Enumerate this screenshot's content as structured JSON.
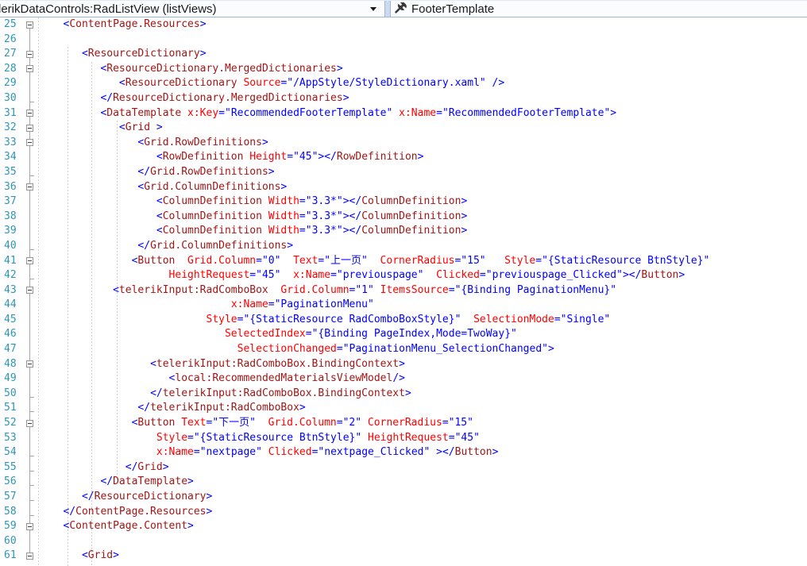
{
  "navbar": {
    "element_dropdown": {
      "label": "lerikDataControls:RadListView (listViews)",
      "caret_icon": "caret-down"
    },
    "member_dropdown": {
      "label": "FooterTemplate",
      "icon": "wrench-icon"
    }
  },
  "colors": {
    "delimiter": "#0000FF",
    "element_name": "#A31515",
    "attribute_name": "#FF0000",
    "attribute_value": "#0000FF",
    "line_number": "#2E95B5",
    "navbar_border": "#9CB6D4"
  },
  "editor": {
    "first_line": 25,
    "last_line": 61,
    "lines": [
      {
        "num": 25,
        "fold": true,
        "indent": 3,
        "segments": [
          [
            "d",
            "<"
          ],
          [
            "e",
            "ContentPage.Resources"
          ],
          [
            "d",
            ">"
          ]
        ]
      },
      {
        "num": 26,
        "indent": 0,
        "segments": []
      },
      {
        "num": 27,
        "fold": true,
        "indent": 6,
        "segments": [
          [
            "d",
            "<"
          ],
          [
            "e",
            "ResourceDictionary"
          ],
          [
            "d",
            ">"
          ]
        ]
      },
      {
        "num": 28,
        "fold": true,
        "indent": 9,
        "segments": [
          [
            "d",
            "<"
          ],
          [
            "e",
            "ResourceDictionary.MergedDictionaries"
          ],
          [
            "d",
            ">"
          ]
        ]
      },
      {
        "num": 29,
        "indent": 12,
        "segments": [
          [
            "d",
            "<"
          ],
          [
            "e",
            "ResourceDictionary"
          ],
          [
            "s",
            " "
          ],
          [
            "a",
            "Source"
          ],
          [
            "d",
            "="
          ],
          [
            "v",
            "\"/AppStyle/StyleDictionary.xaml\""
          ],
          [
            "s",
            " "
          ],
          [
            "d",
            "/>"
          ]
        ]
      },
      {
        "num": 30,
        "tick": true,
        "indent": 9,
        "segments": [
          [
            "d",
            "</"
          ],
          [
            "e",
            "ResourceDictionary.MergedDictionaries"
          ],
          [
            "d",
            ">"
          ]
        ]
      },
      {
        "num": 31,
        "fold": true,
        "indent": 9,
        "segments": [
          [
            "d",
            "<"
          ],
          [
            "e",
            "DataTemplate"
          ],
          [
            "s",
            " "
          ],
          [
            "a",
            "x:Key"
          ],
          [
            "d",
            "="
          ],
          [
            "v",
            "\"RecommendedFooterTemplate\""
          ],
          [
            "s",
            " "
          ],
          [
            "a",
            "x:Name"
          ],
          [
            "d",
            "="
          ],
          [
            "v",
            "\"RecommendedFooterTemplate\""
          ],
          [
            "d",
            ">"
          ]
        ]
      },
      {
        "num": 32,
        "fold": true,
        "indent": 12,
        "segments": [
          [
            "d",
            "<"
          ],
          [
            "e",
            "Grid"
          ],
          [
            "s",
            " "
          ],
          [
            "d",
            ">"
          ]
        ]
      },
      {
        "num": 33,
        "fold": true,
        "indent": 15,
        "segments": [
          [
            "d",
            "<"
          ],
          [
            "e",
            "Grid.RowDefinitions"
          ],
          [
            "d",
            ">"
          ]
        ]
      },
      {
        "num": 34,
        "indent": 18,
        "segments": [
          [
            "d",
            "<"
          ],
          [
            "e",
            "RowDefinition"
          ],
          [
            "s",
            " "
          ],
          [
            "a",
            "Height"
          ],
          [
            "d",
            "="
          ],
          [
            "v",
            "\"45\""
          ],
          [
            "d",
            "></"
          ],
          [
            "e",
            "RowDefinition"
          ],
          [
            "d",
            ">"
          ]
        ]
      },
      {
        "num": 35,
        "tick": true,
        "indent": 15,
        "segments": [
          [
            "d",
            "</"
          ],
          [
            "e",
            "Grid.RowDefinitions"
          ],
          [
            "d",
            ">"
          ]
        ]
      },
      {
        "num": 36,
        "fold": true,
        "indent": 15,
        "segments": [
          [
            "d",
            "<"
          ],
          [
            "e",
            "Grid.ColumnDefinitions"
          ],
          [
            "d",
            ">"
          ]
        ]
      },
      {
        "num": 37,
        "indent": 18,
        "segments": [
          [
            "d",
            "<"
          ],
          [
            "e",
            "ColumnDefinition"
          ],
          [
            "s",
            " "
          ],
          [
            "a",
            "Width"
          ],
          [
            "d",
            "="
          ],
          [
            "v",
            "\"3.3*\""
          ],
          [
            "d",
            "></"
          ],
          [
            "e",
            "ColumnDefinition"
          ],
          [
            "d",
            ">"
          ]
        ]
      },
      {
        "num": 38,
        "indent": 18,
        "segments": [
          [
            "d",
            "<"
          ],
          [
            "e",
            "ColumnDefinition"
          ],
          [
            "s",
            " "
          ],
          [
            "a",
            "Width"
          ],
          [
            "d",
            "="
          ],
          [
            "v",
            "\"3.3*\""
          ],
          [
            "d",
            "></"
          ],
          [
            "e",
            "ColumnDefinition"
          ],
          [
            "d",
            ">"
          ]
        ]
      },
      {
        "num": 39,
        "indent": 18,
        "segments": [
          [
            "d",
            "<"
          ],
          [
            "e",
            "ColumnDefinition"
          ],
          [
            "s",
            " "
          ],
          [
            "a",
            "Width"
          ],
          [
            "d",
            "="
          ],
          [
            "v",
            "\"3.3*\""
          ],
          [
            "d",
            "></"
          ],
          [
            "e",
            "ColumnDefinition"
          ],
          [
            "d",
            ">"
          ]
        ]
      },
      {
        "num": 40,
        "tick": true,
        "indent": 15,
        "segments": [
          [
            "d",
            "</"
          ],
          [
            "e",
            "Grid.ColumnDefinitions"
          ],
          [
            "d",
            ">"
          ]
        ]
      },
      {
        "num": 41,
        "fold": true,
        "indent": 14,
        "segments": [
          [
            "d",
            "<"
          ],
          [
            "e",
            "Button"
          ],
          [
            "s",
            "  "
          ],
          [
            "a",
            "Grid.Column"
          ],
          [
            "d",
            "="
          ],
          [
            "v",
            "\"0\""
          ],
          [
            "s",
            "  "
          ],
          [
            "a",
            "Text"
          ],
          [
            "d",
            "="
          ],
          [
            "v",
            "\"上一页\""
          ],
          [
            "s",
            "  "
          ],
          [
            "a",
            "CornerRadius"
          ],
          [
            "d",
            "="
          ],
          [
            "v",
            "\"15\""
          ],
          [
            "s",
            "   "
          ],
          [
            "a",
            "Style"
          ],
          [
            "d",
            "="
          ],
          [
            "v",
            "\"{StaticResource BtnStyle}\""
          ]
        ]
      },
      {
        "num": 42,
        "tick": true,
        "indent": 20,
        "segments": [
          [
            "a",
            "HeightRequest"
          ],
          [
            "d",
            "="
          ],
          [
            "v",
            "\"45\""
          ],
          [
            "s",
            "  "
          ],
          [
            "a",
            "x:Name"
          ],
          [
            "d",
            "="
          ],
          [
            "v",
            "\"previouspage\""
          ],
          [
            "s",
            "  "
          ],
          [
            "a",
            "Clicked"
          ],
          [
            "d",
            "="
          ],
          [
            "v",
            "\"previouspage_Clicked\""
          ],
          [
            "d",
            "></"
          ],
          [
            "e",
            "Button"
          ],
          [
            "d",
            ">"
          ]
        ]
      },
      {
        "num": 43,
        "fold": true,
        "indent": 11,
        "segments": [
          [
            "d",
            "<"
          ],
          [
            "e",
            "telerikInput:RadComboBox"
          ],
          [
            "s",
            "  "
          ],
          [
            "a",
            "Grid.Column"
          ],
          [
            "d",
            "="
          ],
          [
            "v",
            "\"1\""
          ],
          [
            "s",
            " "
          ],
          [
            "a",
            "ItemsSource"
          ],
          [
            "d",
            "="
          ],
          [
            "v",
            "\"{Binding PaginationMenu}\""
          ]
        ]
      },
      {
        "num": 44,
        "indent": 30,
        "segments": [
          [
            "a",
            "x:Name"
          ],
          [
            "d",
            "="
          ],
          [
            "v",
            "\"PaginationMenu\""
          ]
        ]
      },
      {
        "num": 45,
        "indent": 26,
        "segments": [
          [
            "a",
            "Style"
          ],
          [
            "d",
            "="
          ],
          [
            "v",
            "\"{StaticResource RadComboBoxStyle}\""
          ],
          [
            "s",
            "  "
          ],
          [
            "a",
            "SelectionMode"
          ],
          [
            "d",
            "="
          ],
          [
            "v",
            "\"Single\""
          ]
        ]
      },
      {
        "num": 46,
        "indent": 29,
        "segments": [
          [
            "a",
            "SelectedIndex"
          ],
          [
            "d",
            "="
          ],
          [
            "v",
            "\"{Binding PageIndex,Mode=TwoWay}\""
          ]
        ]
      },
      {
        "num": 47,
        "indent": 31,
        "segments": [
          [
            "a",
            "SelectionChanged"
          ],
          [
            "d",
            "="
          ],
          [
            "v",
            "\"PaginationMenu_SelectionChanged\""
          ],
          [
            "d",
            ">"
          ]
        ]
      },
      {
        "num": 48,
        "fold": true,
        "indent": 17,
        "segments": [
          [
            "d",
            "<"
          ],
          [
            "e",
            "telerikInput:RadComboBox.BindingContext"
          ],
          [
            "d",
            ">"
          ]
        ]
      },
      {
        "num": 49,
        "indent": 20,
        "segments": [
          [
            "d",
            "<"
          ],
          [
            "e",
            "local:RecommendedMaterialsViewModel"
          ],
          [
            "d",
            "/>"
          ]
        ]
      },
      {
        "num": 50,
        "tick": true,
        "indent": 17,
        "segments": [
          [
            "d",
            "</"
          ],
          [
            "e",
            "telerikInput:RadComboBox.BindingContext"
          ],
          [
            "d",
            ">"
          ]
        ]
      },
      {
        "num": 51,
        "tick": true,
        "indent": 15,
        "segments": [
          [
            "d",
            "</"
          ],
          [
            "e",
            "telerikInput:RadComboBox"
          ],
          [
            "d",
            ">"
          ]
        ]
      },
      {
        "num": 52,
        "fold": true,
        "indent": 14,
        "segments": [
          [
            "d",
            "<"
          ],
          [
            "e",
            "Button"
          ],
          [
            "s",
            " "
          ],
          [
            "a",
            "Text"
          ],
          [
            "d",
            "="
          ],
          [
            "v",
            "\"下一页\""
          ],
          [
            "s",
            "  "
          ],
          [
            "a",
            "Grid.Column"
          ],
          [
            "d",
            "="
          ],
          [
            "v",
            "\"2\""
          ],
          [
            "s",
            " "
          ],
          [
            "a",
            "CornerRadius"
          ],
          [
            "d",
            "="
          ],
          [
            "v",
            "\"15\""
          ]
        ]
      },
      {
        "num": 53,
        "indent": 18,
        "segments": [
          [
            "a",
            "Style"
          ],
          [
            "d",
            "="
          ],
          [
            "v",
            "\"{StaticResource BtnStyle}\""
          ],
          [
            "s",
            " "
          ],
          [
            "a",
            "HeightRequest"
          ],
          [
            "d",
            "="
          ],
          [
            "v",
            "\"45\""
          ]
        ]
      },
      {
        "num": 54,
        "tick": true,
        "indent": 18,
        "segments": [
          [
            "a",
            "x:Name"
          ],
          [
            "d",
            "="
          ],
          [
            "v",
            "\"nextpage\""
          ],
          [
            "s",
            " "
          ],
          [
            "a",
            "Clicked"
          ],
          [
            "d",
            "="
          ],
          [
            "v",
            "\"nextpage_Clicked\""
          ],
          [
            "s",
            " "
          ],
          [
            "d",
            "></"
          ],
          [
            "e",
            "Button"
          ],
          [
            "d",
            ">"
          ]
        ]
      },
      {
        "num": 55,
        "tick": true,
        "indent": 13,
        "segments": [
          [
            "d",
            "</"
          ],
          [
            "e",
            "Grid"
          ],
          [
            "d",
            ">"
          ]
        ]
      },
      {
        "num": 56,
        "tick": true,
        "indent": 9,
        "segments": [
          [
            "d",
            "</"
          ],
          [
            "e",
            "DataTemplate"
          ],
          [
            "d",
            ">"
          ]
        ]
      },
      {
        "num": 57,
        "tick": true,
        "indent": 6,
        "segments": [
          [
            "d",
            "</"
          ],
          [
            "e",
            "ResourceDictionary"
          ],
          [
            "d",
            ">"
          ]
        ]
      },
      {
        "num": 58,
        "tick": true,
        "indent": 3,
        "segments": [
          [
            "d",
            "</"
          ],
          [
            "e",
            "ContentPage.Resources"
          ],
          [
            "d",
            ">"
          ]
        ]
      },
      {
        "num": 59,
        "fold": true,
        "indent": 3,
        "segments": [
          [
            "d",
            "<"
          ],
          [
            "e",
            "ContentPage.Content"
          ],
          [
            "d",
            ">"
          ]
        ]
      },
      {
        "num": 60,
        "indent": 0,
        "segments": []
      },
      {
        "num": 61,
        "fold": true,
        "indent": 6,
        "segments": [
          [
            "d",
            "<"
          ],
          [
            "e",
            "Grid"
          ],
          [
            "d",
            ">"
          ]
        ]
      }
    ]
  }
}
